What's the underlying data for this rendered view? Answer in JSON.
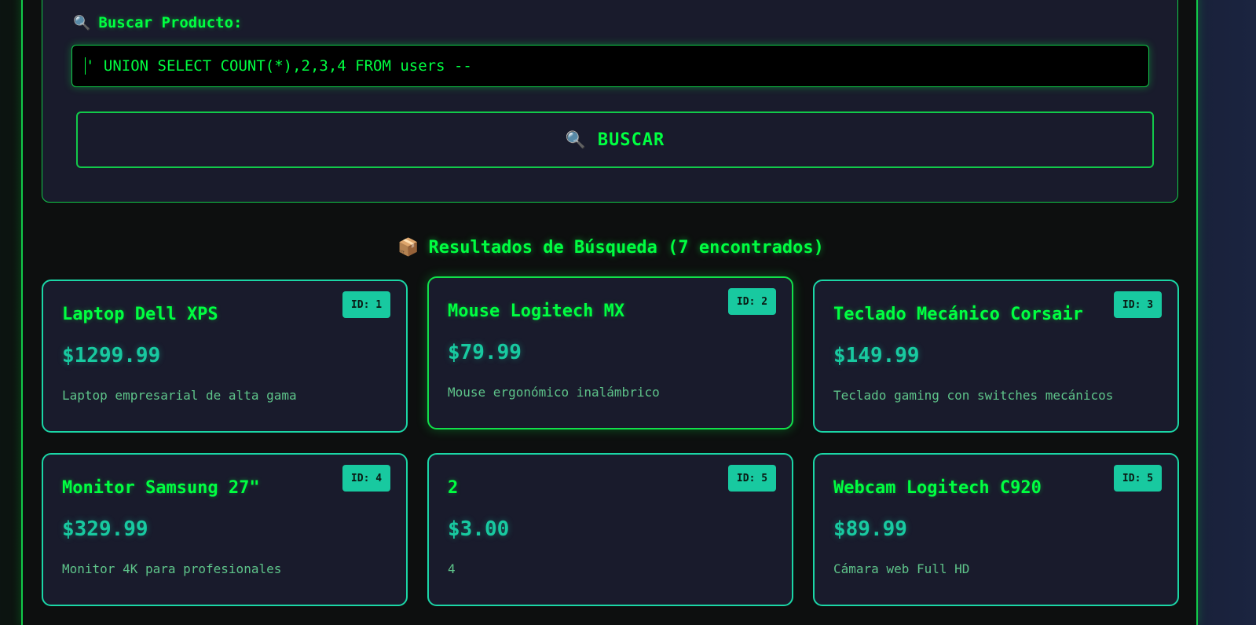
{
  "search": {
    "label": "Buscar Producto:",
    "label_icon": "magnifier-icon",
    "input_value": "' UNION SELECT COUNT(*),2,3,4 FROM users --",
    "button_label": "BUSCAR",
    "button_icon": "magnifier-icon"
  },
  "results": {
    "title": "Resultados de Búsqueda (7 encontrados)",
    "title_icon": "package-icon",
    "products": [
      {
        "id_label": "ID: 1",
        "name": "Laptop Dell XPS",
        "price": "$1299.99",
        "description": "Laptop empresarial de alta gama"
      },
      {
        "id_label": "ID: 2",
        "name": "Mouse Logitech MX",
        "price": "$79.99",
        "description": "Mouse ergonómico inalámbrico"
      },
      {
        "id_label": "ID: 3",
        "name": "Teclado Mecánico Corsair",
        "price": "$149.99",
        "description": "Teclado gaming con switches mecánicos"
      },
      {
        "id_label": "ID: 4",
        "name": "Monitor Samsung 27\"",
        "price": "$329.99",
        "description": "Monitor 4K para profesionales"
      },
      {
        "id_label": "ID: 5",
        "name": "2",
        "price": "$3.00",
        "description": "4"
      },
      {
        "id_label": "ID: 5",
        "name": "Webcam Logitech C920",
        "price": "$89.99",
        "description": "Cámara web Full HD"
      }
    ]
  },
  "colors": {
    "accent_green": "#00ff41",
    "accent_teal": "#18c9a0",
    "panel_bg": "#191b2c",
    "page_bg": "#0d0f0f"
  }
}
